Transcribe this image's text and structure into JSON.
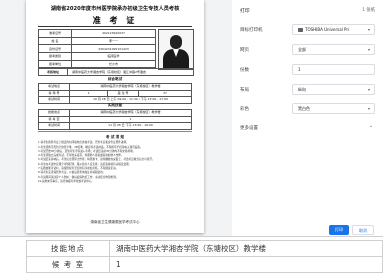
{
  "document": {
    "title": "湖南省2020年度市州医学院承办初级卫生专技人员考核",
    "subtitle": "准 考 证",
    "photo_alt": "photo",
    "info_rows": [
      {
        "k": "准考证号",
        "v": "402123920037"
      },
      {
        "k": "姓    名",
        "v": "李一一"
      },
      {
        "k": "身份证号",
        "v": "4304231095101423"
      },
      {
        "k": "报考类别",
        "v": "临床医学"
      },
      {
        "k": "报考单位",
        "v": "长沙市"
      }
    ],
    "exam_site_label": "考核地址",
    "exam_site_value": "湖南中医药大学湘杏学院（东塘校区）湘江中路2号湘杏",
    "written_title": "综合笔试",
    "written_rows": [
      [
        "考试地点",
        "湖南中医药大学湘杏学院（东塘校区）教学楼",
        "",
        ""
      ],
      [
        "考 场 号",
        "1",
        "座 位 号",
        "37"
      ],
      [
        "考试时间",
        "10 月 28 日  上午 09:00 - 11:30 / 下午 13:00 - 17:00",
        "",
        ""
      ]
    ],
    "skill_title": "实践技能",
    "skill_rows": [
      [
        "技能地点",
        "湖南中医药大学湘杏学院（东塘校区）教学楼",
        "",
        ""
      ],
      [
        "候 考 室",
        "1",
        "",
        ""
      ],
      [
        "考试时间",
        "11 月 28 日  下午 13:00 - 16:00",
        "",
        ""
      ]
    ],
    "notes_heading": "考 试 须 知",
    "notes": [
      "1.请考生按准考证上规定的时间和地点参加考试，凭准考证和身份证原件进场。",
      "2.考生须携带黑色字迹签字笔、2B铅笔、橡皮等考试用品，不得携带手机等电子通讯设备。",
      "3.考试开始30分钟后，迟到考生不得进入考场；考试结束前30分钟内不得交卷离场。",
      "4.考生须独立完成考试，不得交头接耳、抄袭他人答案或者协助他人作弊。",
      "5.考试结束铃响后，考生应立即停止作答，将答题卡、试卷翻放在桌面上，待监考员收齐后方可离开。",
      "6.考生在考试中应遵守考场纪律，服从监考人员安排，违纪者将按有关规定处理。",
      "7.实践技能考试时，请按照候考室安排有序参加考核，不得随意走动。",
      "8.请考生妥善保管准考证，以备后续查询和证书领取使用。",
      "9.考试期间请注意个人防护，做好疫情防控工作，主动配合体温检测。",
      "10.其他未尽事宜，请咨询报考单位或考试中心。"
    ],
    "footer": "湖南省卫生健康委医学考试中心"
  },
  "panel": {
    "title": "打印",
    "page_count": "1 张纸",
    "destination_label": "目标打印机",
    "destination_value": "TOSHIBA Universal Pri",
    "pages_label": "网页",
    "pages_value": "全部",
    "copies_label": "份数",
    "copies_value": "1",
    "layout_label": "布局",
    "layout_value": "纵向",
    "color_label": "彩色",
    "color_value": "黑白色",
    "more_label": "更多设置",
    "print_button": "打印",
    "cancel_button": "取消"
  },
  "underlying": {
    "rows": [
      {
        "k": "技能地点",
        "v": "湖南中医药大学湘杏学院（东塘校区）教学楼"
      },
      {
        "k": "候 考 室",
        "v": "1"
      }
    ]
  },
  "colors": {
    "accent": "#1a73e8",
    "preview_bg": "#f1f3f4"
  }
}
